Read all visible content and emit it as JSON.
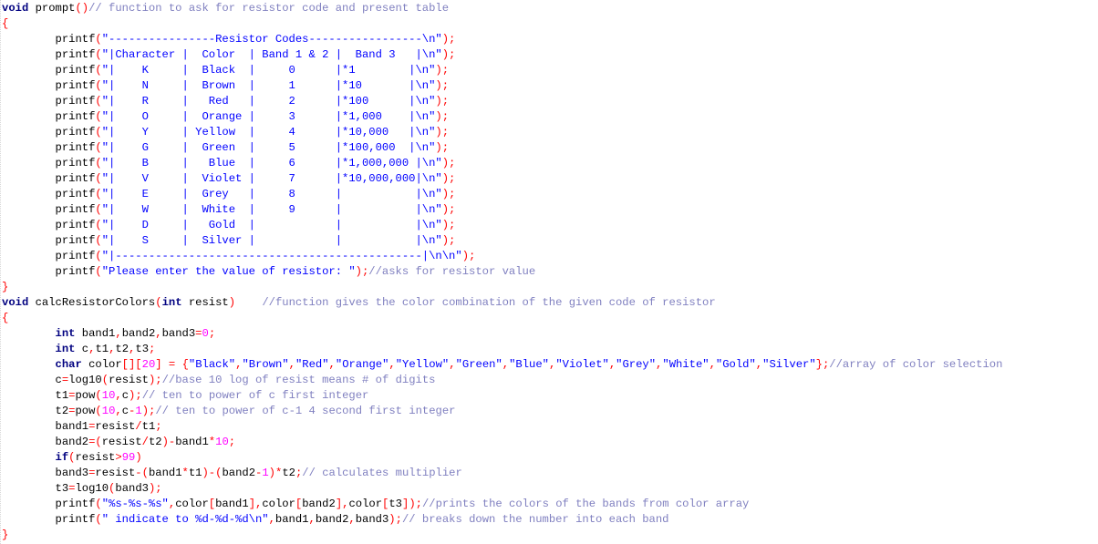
{
  "editor": {
    "language": "C",
    "lines": [
      [
        [
          "kw",
          "void"
        ],
        [
          "id",
          " prompt"
        ],
        [
          "op",
          "()"
        ],
        [
          "cm",
          "// function to ask for resistor code and present table"
        ]
      ],
      [
        [
          "op",
          "{"
        ]
      ],
      [
        [
          "id",
          "        printf"
        ],
        [
          "op",
          "("
        ],
        [
          "str",
          "\"----------------Resistor Codes-----------------\\n\""
        ],
        [
          "op",
          ");"
        ]
      ],
      [
        [
          "id",
          "        printf"
        ],
        [
          "op",
          "("
        ],
        [
          "str",
          "\"|Character |  Color  | Band 1 & 2 |  Band 3   |\\n\""
        ],
        [
          "op",
          ");"
        ]
      ],
      [
        [
          "id",
          "        printf"
        ],
        [
          "op",
          "("
        ],
        [
          "str",
          "\"|    K     |  Black  |     0      |*1        |\\n\""
        ],
        [
          "op",
          ");"
        ]
      ],
      [
        [
          "id",
          "        printf"
        ],
        [
          "op",
          "("
        ],
        [
          "str",
          "\"|    N     |  Brown  |     1      |*10       |\\n\""
        ],
        [
          "op",
          ");"
        ]
      ],
      [
        [
          "id",
          "        printf"
        ],
        [
          "op",
          "("
        ],
        [
          "str",
          "\"|    R     |   Red   |     2      |*100      |\\n\""
        ],
        [
          "op",
          ");"
        ]
      ],
      [
        [
          "id",
          "        printf"
        ],
        [
          "op",
          "("
        ],
        [
          "str",
          "\"|    O     |  Orange |     3      |*1,000    |\\n\""
        ],
        [
          "op",
          ");"
        ]
      ],
      [
        [
          "id",
          "        printf"
        ],
        [
          "op",
          "("
        ],
        [
          "str",
          "\"|    Y     | Yellow  |     4      |*10,000   |\\n\""
        ],
        [
          "op",
          ");"
        ]
      ],
      [
        [
          "id",
          "        printf"
        ],
        [
          "op",
          "("
        ],
        [
          "str",
          "\"|    G     |  Green  |     5      |*100,000  |\\n\""
        ],
        [
          "op",
          ");"
        ]
      ],
      [
        [
          "id",
          "        printf"
        ],
        [
          "op",
          "("
        ],
        [
          "str",
          "\"|    B     |   Blue  |     6      |*1,000,000 |\\n\""
        ],
        [
          "op",
          ");"
        ]
      ],
      [
        [
          "id",
          "        printf"
        ],
        [
          "op",
          "("
        ],
        [
          "str",
          "\"|    V     |  Violet |     7      |*10,000,000|\\n\""
        ],
        [
          "op",
          ");"
        ]
      ],
      [
        [
          "id",
          "        printf"
        ],
        [
          "op",
          "("
        ],
        [
          "str",
          "\"|    E     |  Grey   |     8      |           |\\n\""
        ],
        [
          "op",
          ");"
        ]
      ],
      [
        [
          "id",
          "        printf"
        ],
        [
          "op",
          "("
        ],
        [
          "str",
          "\"|    W     |  White  |     9      |           |\\n\""
        ],
        [
          "op",
          ");"
        ]
      ],
      [
        [
          "id",
          "        printf"
        ],
        [
          "op",
          "("
        ],
        [
          "str",
          "\"|    D     |   Gold  |            |           |\\n\""
        ],
        [
          "op",
          ");"
        ]
      ],
      [
        [
          "id",
          "        printf"
        ],
        [
          "op",
          "("
        ],
        [
          "str",
          "\"|    S     |  Silver |            |           |\\n\""
        ],
        [
          "op",
          ");"
        ]
      ],
      [
        [
          "id",
          "        printf"
        ],
        [
          "op",
          "("
        ],
        [
          "str",
          "\"|----------------------------------------------|\\n\\n\""
        ],
        [
          "op",
          ");"
        ]
      ],
      [
        [
          "id",
          "        printf"
        ],
        [
          "op",
          "("
        ],
        [
          "str",
          "\"Please enter the value of resistor: \""
        ],
        [
          "op",
          ");"
        ],
        [
          "cm",
          "//asks for resistor value"
        ]
      ],
      [
        [
          "op",
          "}"
        ]
      ],
      [
        [
          "kw",
          "void"
        ],
        [
          "id",
          " calcResistorColors"
        ],
        [
          "op",
          "("
        ],
        [
          "kw",
          "int"
        ],
        [
          "id",
          " resist"
        ],
        [
          "op",
          ")"
        ],
        [
          "id",
          "    "
        ],
        [
          "cm",
          "//function gives the color combination of the given code of resistor"
        ]
      ],
      [
        [
          "op",
          "{"
        ]
      ],
      [
        [
          "id",
          "        "
        ],
        [
          "kw",
          "int"
        ],
        [
          "id",
          " band1"
        ],
        [
          "op",
          ","
        ],
        [
          "id",
          "band2"
        ],
        [
          "op",
          ","
        ],
        [
          "id",
          "band3"
        ],
        [
          "op",
          "="
        ],
        [
          "num",
          "0"
        ],
        [
          "op",
          ";"
        ]
      ],
      [
        [
          "id",
          "        "
        ],
        [
          "kw",
          "int"
        ],
        [
          "id",
          " c"
        ],
        [
          "op",
          ","
        ],
        [
          "id",
          "t1"
        ],
        [
          "op",
          ","
        ],
        [
          "id",
          "t2"
        ],
        [
          "op",
          ","
        ],
        [
          "id",
          "t3"
        ],
        [
          "op",
          ";"
        ]
      ],
      [
        [
          "id",
          "        "
        ],
        [
          "kw",
          "char"
        ],
        [
          "id",
          " color"
        ],
        [
          "op",
          "[]["
        ],
        [
          "num",
          "20"
        ],
        [
          "op",
          "]"
        ],
        [
          "id",
          " "
        ],
        [
          "op",
          "="
        ],
        [
          "id",
          " "
        ],
        [
          "op",
          "{"
        ],
        [
          "str",
          "\"Black\""
        ],
        [
          "op",
          ","
        ],
        [
          "str",
          "\"Brown\""
        ],
        [
          "op",
          ","
        ],
        [
          "str",
          "\"Red\""
        ],
        [
          "op",
          ","
        ],
        [
          "str",
          "\"Orange\""
        ],
        [
          "op",
          ","
        ],
        [
          "str",
          "\"Yellow\""
        ],
        [
          "op",
          ","
        ],
        [
          "str",
          "\"Green\""
        ],
        [
          "op",
          ","
        ],
        [
          "str",
          "\"Blue\""
        ],
        [
          "op",
          ","
        ],
        [
          "str",
          "\"Violet\""
        ],
        [
          "op",
          ","
        ],
        [
          "str",
          "\"Grey\""
        ],
        [
          "op",
          ","
        ],
        [
          "str",
          "\"White\""
        ],
        [
          "op",
          ","
        ],
        [
          "str",
          "\"Gold\""
        ],
        [
          "op",
          ","
        ],
        [
          "str",
          "\"Silver\""
        ],
        [
          "op",
          "};"
        ],
        [
          "cm",
          "//array of color selection"
        ]
      ],
      [
        [
          "id",
          "        c"
        ],
        [
          "op",
          "="
        ],
        [
          "id",
          "log10"
        ],
        [
          "op",
          "("
        ],
        [
          "id",
          "resist"
        ],
        [
          "op",
          ");"
        ],
        [
          "cm",
          "//base 10 log of resist means # of digits"
        ]
      ],
      [
        [
          "id",
          "        t1"
        ],
        [
          "op",
          "="
        ],
        [
          "id",
          "pow"
        ],
        [
          "op",
          "("
        ],
        [
          "num",
          "10"
        ],
        [
          "op",
          ","
        ],
        [
          "id",
          "c"
        ],
        [
          "op",
          ");"
        ],
        [
          "cm",
          "// ten to power of c first integer"
        ]
      ],
      [
        [
          "id",
          "        t2"
        ],
        [
          "op",
          "="
        ],
        [
          "id",
          "pow"
        ],
        [
          "op",
          "("
        ],
        [
          "num",
          "10"
        ],
        [
          "op",
          ","
        ],
        [
          "id",
          "c"
        ],
        [
          "op",
          "-"
        ],
        [
          "num",
          "1"
        ],
        [
          "op",
          ");"
        ],
        [
          "cm",
          "// ten to power of c-1 4 second first integer"
        ]
      ],
      [
        [
          "id",
          "        band1"
        ],
        [
          "op",
          "="
        ],
        [
          "id",
          "resist"
        ],
        [
          "op",
          "/"
        ],
        [
          "id",
          "t1"
        ],
        [
          "op",
          ";"
        ]
      ],
      [
        [
          "id",
          "        band2"
        ],
        [
          "op",
          "=("
        ],
        [
          "id",
          "resist"
        ],
        [
          "op",
          "/"
        ],
        [
          "id",
          "t2"
        ],
        [
          "op",
          ")-"
        ],
        [
          "id",
          "band1"
        ],
        [
          "op",
          "*"
        ],
        [
          "num",
          "10"
        ],
        [
          "op",
          ";"
        ]
      ],
      [
        [
          "id",
          "        "
        ],
        [
          "kw",
          "if"
        ],
        [
          "op",
          "("
        ],
        [
          "id",
          "resist"
        ],
        [
          "op",
          ">"
        ],
        [
          "num",
          "99"
        ],
        [
          "op",
          ")"
        ]
      ],
      [
        [
          "id",
          "        band3"
        ],
        [
          "op",
          "="
        ],
        [
          "id",
          "resist"
        ],
        [
          "op",
          "-("
        ],
        [
          "id",
          "band1"
        ],
        [
          "op",
          "*"
        ],
        [
          "id",
          "t1"
        ],
        [
          "op",
          ")-("
        ],
        [
          "id",
          "band2"
        ],
        [
          "op",
          "-"
        ],
        [
          "num",
          "1"
        ],
        [
          "op",
          ")*"
        ],
        [
          "id",
          "t2"
        ],
        [
          "op",
          ";"
        ],
        [
          "cm",
          "// calculates multiplier"
        ]
      ],
      [
        [
          "id",
          "        t3"
        ],
        [
          "op",
          "="
        ],
        [
          "id",
          "log10"
        ],
        [
          "op",
          "("
        ],
        [
          "id",
          "band3"
        ],
        [
          "op",
          ");"
        ]
      ],
      [
        [
          "id",
          "        printf"
        ],
        [
          "op",
          "("
        ],
        [
          "str",
          "\"%s-%s-%s\""
        ],
        [
          "op",
          ","
        ],
        [
          "id",
          "color"
        ],
        [
          "op",
          "["
        ],
        [
          "id",
          "band1"
        ],
        [
          "op",
          "],"
        ],
        [
          "id",
          "color"
        ],
        [
          "op",
          "["
        ],
        [
          "id",
          "band2"
        ],
        [
          "op",
          "],"
        ],
        [
          "id",
          "color"
        ],
        [
          "op",
          "["
        ],
        [
          "id",
          "t3"
        ],
        [
          "op",
          "]);"
        ],
        [
          "cm",
          "//prints the colors of the bands from color array"
        ]
      ],
      [
        [
          "id",
          "        printf"
        ],
        [
          "op",
          "("
        ],
        [
          "str",
          "\" indicate to %d-%d-%d\\n\""
        ],
        [
          "op",
          ","
        ],
        [
          "id",
          "band1"
        ],
        [
          "op",
          ","
        ],
        [
          "id",
          "band2"
        ],
        [
          "op",
          ","
        ],
        [
          "id",
          "band3"
        ],
        [
          "op",
          ");"
        ],
        [
          "cm",
          "// breaks down the number into each band"
        ]
      ],
      [
        [
          "op",
          "}"
        ]
      ]
    ]
  }
}
